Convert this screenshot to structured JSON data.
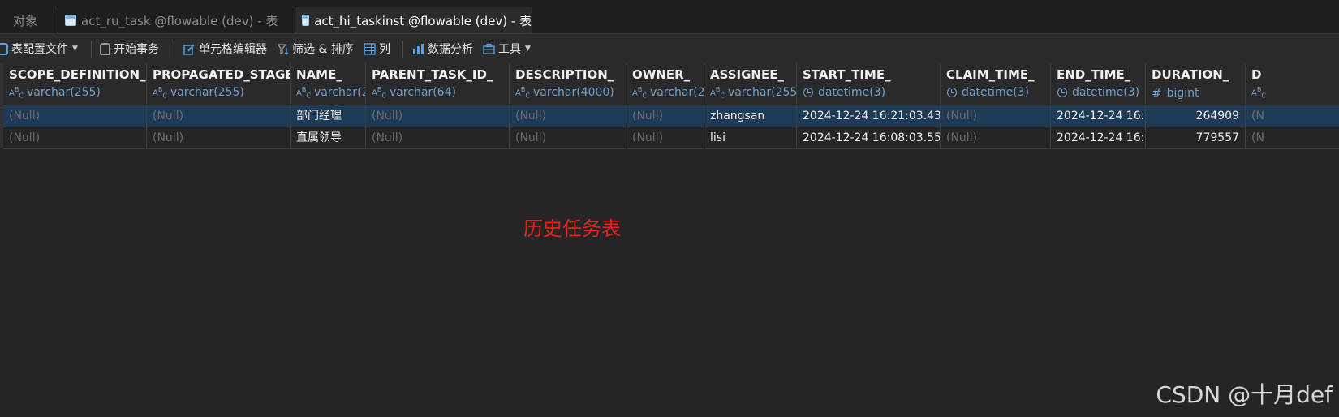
{
  "tabs": [
    {
      "label": "对象",
      "active": false
    },
    {
      "label": "act_ru_task @flowable (dev) - 表",
      "active": false
    },
    {
      "label": "act_hi_taskinst @flowable (dev) - 表",
      "active": true
    }
  ],
  "toolbar": {
    "config": "表配置文件",
    "begin_tx": "开始事务",
    "cell_editor": "单元格编辑器",
    "filter_sort": "筛选 & 排序",
    "columns": "列",
    "data_analysis": "数据分析",
    "tools": "工具"
  },
  "columns": [
    {
      "name": "SCOPE_DEFINITION_II",
      "type": "varchar(255)",
      "kind": "text"
    },
    {
      "name": "PROPAGATED_STAGE",
      "type": "varchar(255)",
      "kind": "text"
    },
    {
      "name": "NAME_",
      "type": "varchar(2",
      "kind": "text"
    },
    {
      "name": "PARENT_TASK_ID_",
      "type": "varchar(64)",
      "kind": "text"
    },
    {
      "name": "DESCRIPTION_",
      "type": "varchar(4000)",
      "kind": "text"
    },
    {
      "name": "OWNER_",
      "type": "varchar(2",
      "kind": "text"
    },
    {
      "name": "ASSIGNEE_",
      "type": "varchar(255",
      "kind": "text"
    },
    {
      "name": "START_TIME_",
      "type": "datetime(3)",
      "kind": "datetime"
    },
    {
      "name": "CLAIM_TIME_",
      "type": "datetime(3)",
      "kind": "datetime"
    },
    {
      "name": "END_TIME_",
      "type": "datetime(3)",
      "kind": "datetime"
    },
    {
      "name": "DURATION_",
      "type": "bigint",
      "kind": "number"
    },
    {
      "name": "D",
      "type": "",
      "kind": "text"
    }
  ],
  "rows": [
    [
      "(Null)",
      "(Null)",
      "部门经理",
      "(Null)",
      "(Null)",
      "(Null)",
      "zhangsan",
      "2024-12-24 16:21:03.43",
      "(Null)",
      "2024-12-24 16:",
      "264909",
      "(N"
    ],
    [
      "(Null)",
      "(Null)",
      "直属领导",
      "(Null)",
      "(Null)",
      "(Null)",
      "lisi",
      "2024-12-24 16:08:03.55",
      "(Null)",
      "2024-12-24 16:",
      "779557",
      "(N"
    ]
  ],
  "annotation": "历史任务表",
  "watermark": "CSDN @十月def",
  "colors": {
    "accent": "#6f9fd1",
    "annotation": "#e3231c",
    "selected_row": "#1d3a56"
  }
}
